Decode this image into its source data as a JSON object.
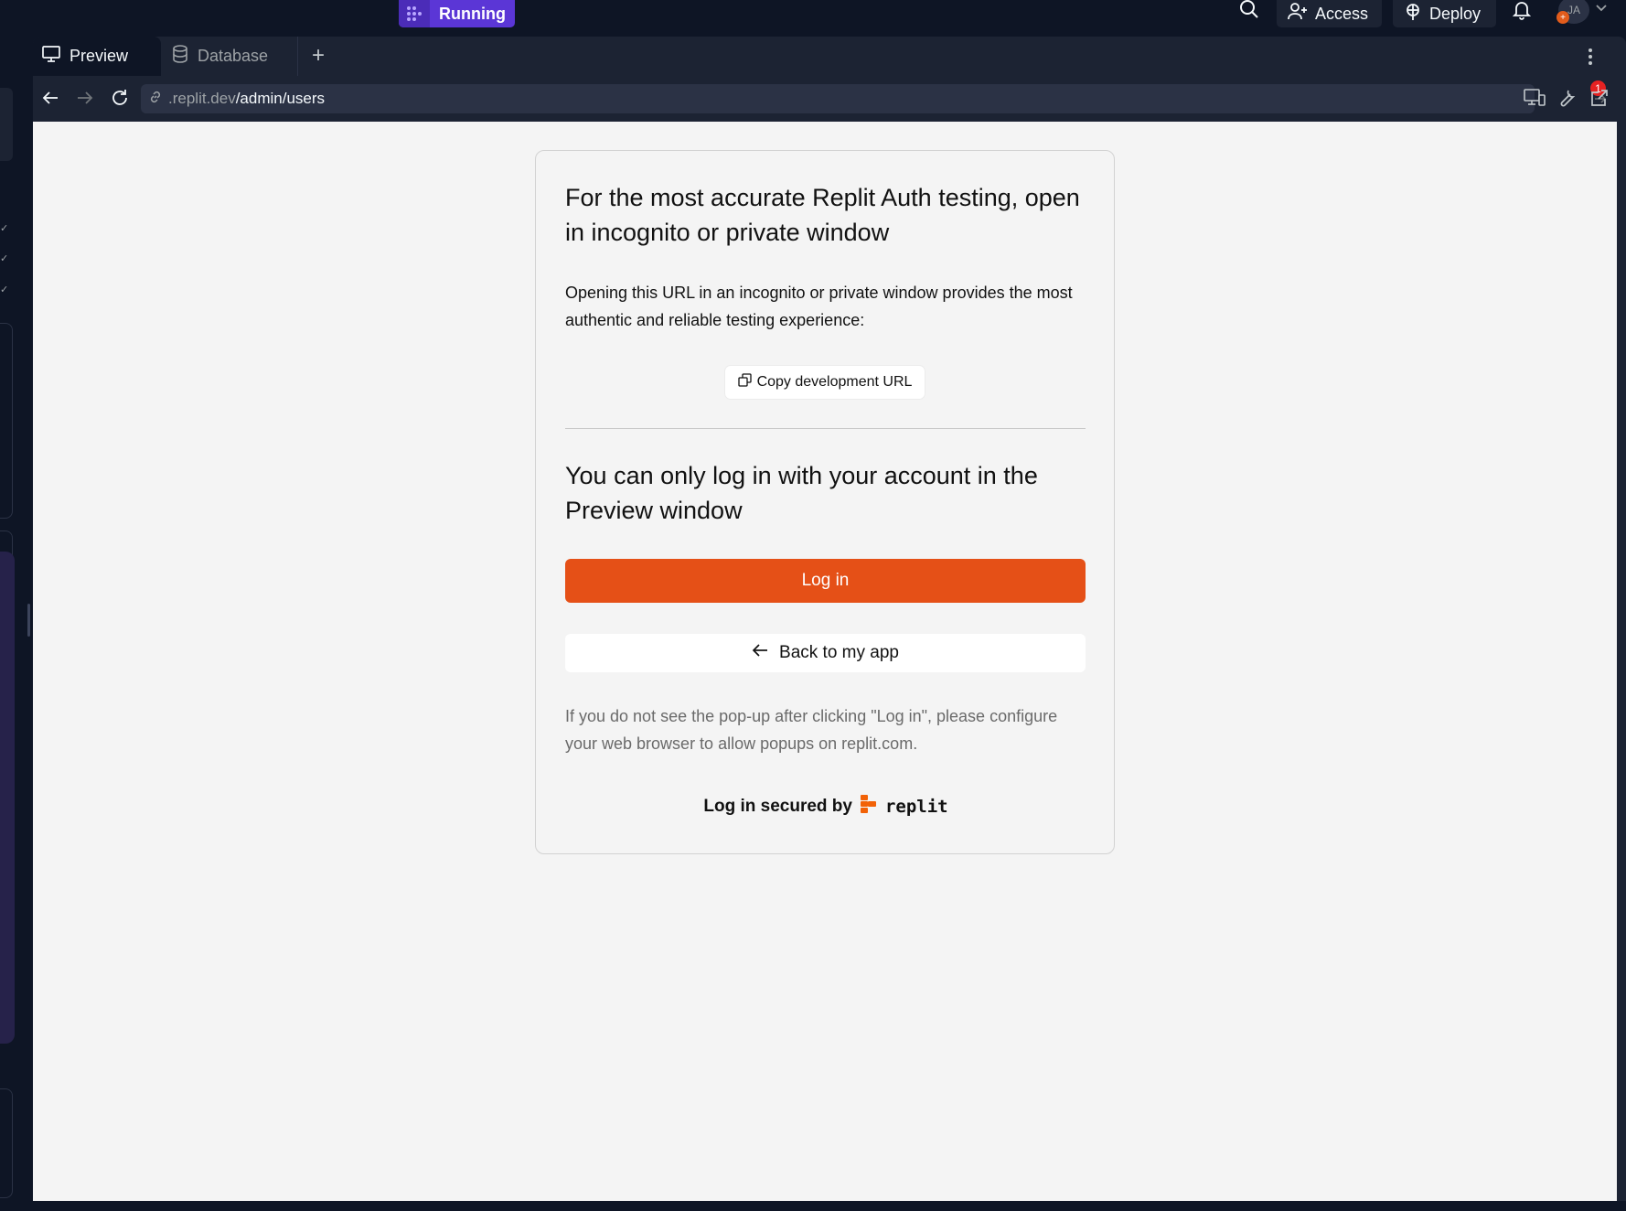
{
  "topbar": {
    "run_status": "Running",
    "access_label": "Access",
    "deploy_label": "Deploy",
    "avatar_initials": "JA",
    "avatar_badge": "+"
  },
  "tabs": [
    {
      "label": "Preview",
      "icon": "monitor-icon",
      "active": true
    },
    {
      "label": "Database",
      "icon": "database-icon",
      "active": false
    }
  ],
  "addressbar": {
    "url_domain": ".replit.dev",
    "url_path": "/admin/users",
    "tools_badge": "1"
  },
  "auth_card": {
    "heading_incognito": "For the most accurate Replit Auth testing, open in incognito or private window",
    "incognito_text": "Opening this URL in an incognito or private window provides the most authentic and reliable testing experience:",
    "copy_url_label": "Copy development URL",
    "heading_login": "You can only log in with your account in the Preview window",
    "login_label": "Log in",
    "back_label": "Back to my app",
    "popup_note": "If you do not see the pop-up after clicking \"Log in\", please configure your web browser to allow popups on replit.com.",
    "secured_by": "Log in secured by",
    "brand": "replit"
  },
  "colors": {
    "accent_orange": "#e55017",
    "running_purple": "#5b36d6",
    "ide_bg": "#0e1525",
    "ide_panel": "#1c2333"
  }
}
